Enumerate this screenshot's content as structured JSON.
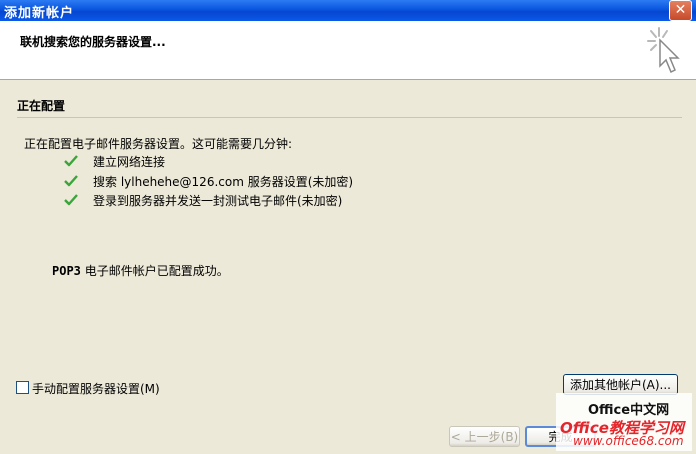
{
  "window": {
    "title": "添加新帐户",
    "close_glyph": "✕"
  },
  "header": {
    "title": "联机搜索您的服务器设置..."
  },
  "section": {
    "title": "正在配置"
  },
  "intro_text": "正在配置电子邮件服务器设置。这可能需要几分钟:",
  "steps": [
    {
      "label": "建立网络连接",
      "icon": "check-icon"
    },
    {
      "label": "搜索 lylhehehe@126.com 服务器设置(未加密)",
      "icon": "check-icon"
    },
    {
      "label": "登录到服务器并发送一封测试电子邮件(未加密)",
      "icon": "check-icon"
    }
  ],
  "success": {
    "protocol": "POP3",
    "message": "电子邮件帐户已配置成功。"
  },
  "manual_config": {
    "label": "手动配置服务器设置(M)",
    "checked": false
  },
  "buttons": {
    "add_other": "添加其他帐户(A)...",
    "back": "< 上一步(B)",
    "finish": "完成"
  },
  "watermark": {
    "line1": "Office中文网",
    "line2": "Office教程学习网",
    "line3": "www.office68.com"
  },
  "colors": {
    "check": "#3aa53a",
    "title_bar": "#0a55e0",
    "background": "#ece9d8"
  }
}
